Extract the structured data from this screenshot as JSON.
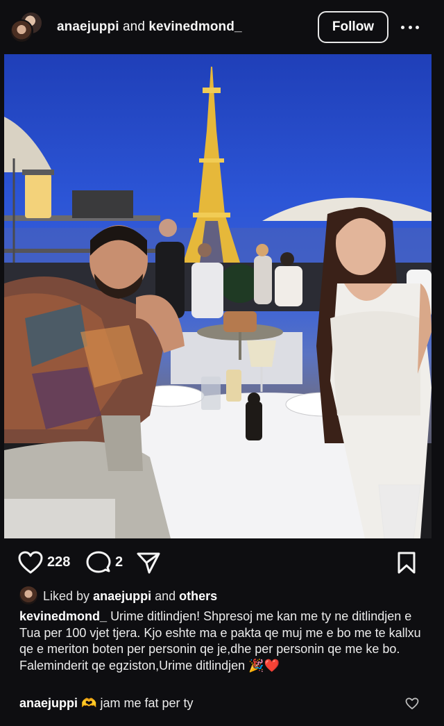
{
  "header": {
    "user1": "anaejuppi",
    "joiner": "and",
    "user2": "kevinedmond_",
    "follow_label": "Follow",
    "more_icon": "more-horizontal-icon"
  },
  "photo": {
    "description_icon": "photo"
  },
  "actions": {
    "likes": "228",
    "comments": "2",
    "heart_icon": "heart-icon",
    "comment_icon": "comment-icon",
    "share_icon": "share-icon",
    "save_icon": "bookmark-icon"
  },
  "liked_by": {
    "prefix": "Liked by",
    "user": "anaejuppi",
    "joiner": "and",
    "others": "others"
  },
  "caption": {
    "author": "kevinedmond_",
    "text": "Urime ditlindjen! Shpresoj me kan me ty ne ditlindjen e Tua per 100 vjet tjera. Kjo eshte ma e pakta qe muj me e bo me te kallxu qe e meriton boten per personin qe je,dhe per personin qe me ke bo. Faleminderit qe egziston,Urime ditlindjen 🎉❤️"
  },
  "comment": {
    "author": "anaejuppi",
    "emoji": "🫶",
    "text": "jam me fat per ty"
  },
  "colors": {
    "background": "#0e0e11",
    "text": "#f2f2f2"
  }
}
